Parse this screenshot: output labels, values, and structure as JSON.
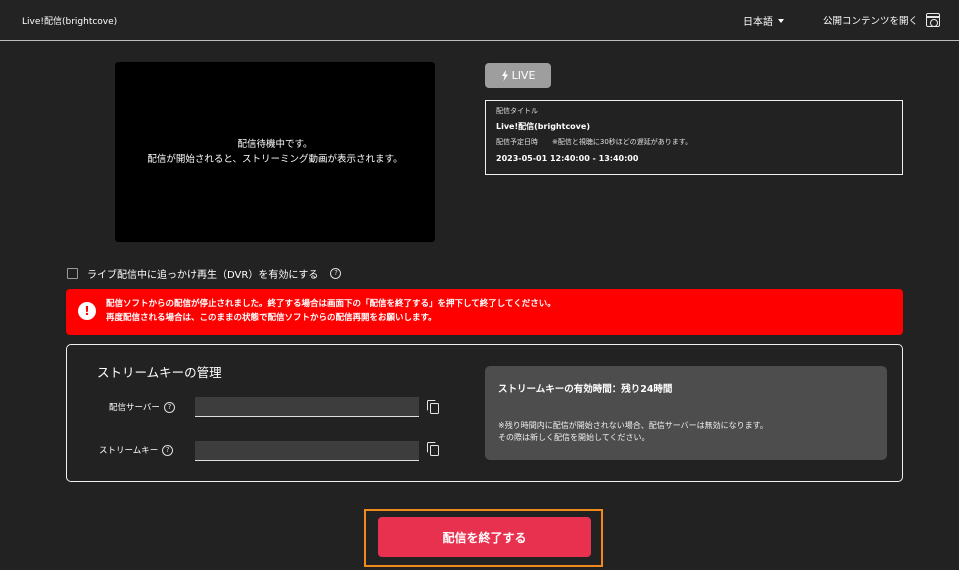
{
  "header": {
    "app_title": "Live!配信(brightcove)",
    "language": "日本語",
    "open_public_label": "公開コンテンツを開く"
  },
  "player": {
    "line1": "配信待機中です。",
    "line2": "配信が開始されると、ストリーミング動画が表示されます。"
  },
  "live_badge": {
    "label": "LIVE",
    "icon": "lightning-icon"
  },
  "info": {
    "title_label": "配信タイトル",
    "title": "Live!配信(brightcove)",
    "schedule_label": "配信予定日時",
    "delay_note": "※配信と視聴に30秒ほどの遅延があります。",
    "schedule": "2023-05-01 12:40:00 - 13:40:00"
  },
  "dvr": {
    "label": "ライブ配信中に追っかけ再生（DVR）を有効にする",
    "checked": false
  },
  "alert": {
    "line1": "配信ソフトからの配信が停止されました。終了する場合は画面下の「配信を終了する」を押下して終了してください。",
    "line2": "再度配信される場合は、このままの状態で配信ソフトからの配信再開をお願いします。",
    "color": "#ff0000"
  },
  "stream_key": {
    "title": "ストリームキーの管理",
    "server_label": "配信サーバー",
    "server_value": "",
    "key_label": "ストリームキー",
    "key_value": "",
    "expiry_title": "ストリームキーの有効時間：残り24時間",
    "expiry_note1": "※残り時間内に配信が開始されない場合、配信サーバーは無効になります。",
    "expiry_note2": "その際は新しく配信を開始してください。"
  },
  "end_button": {
    "label": "配信を終了する",
    "color": "#e8314f",
    "highlight": "#f08a1c"
  }
}
